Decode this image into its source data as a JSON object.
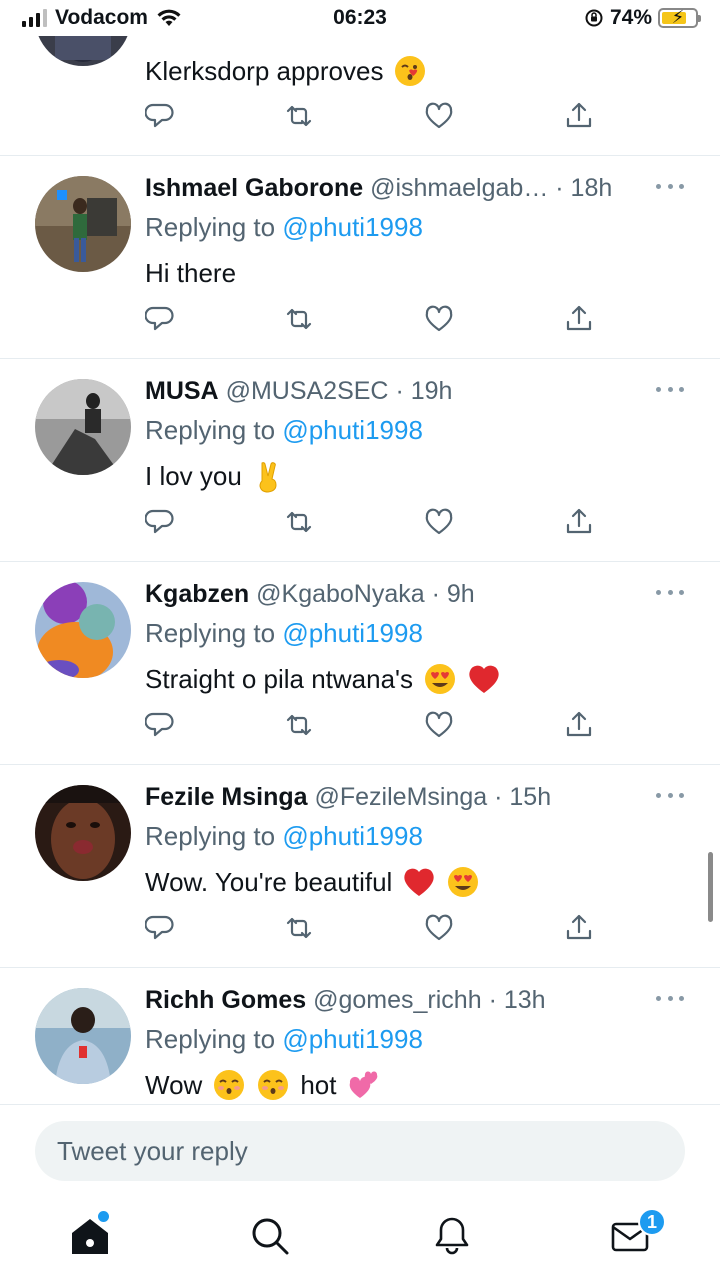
{
  "status_bar": {
    "carrier": "Vodacom",
    "time": "06:23",
    "battery_percent": "74%",
    "battery_level": 0.74
  },
  "top_tweet": {
    "text": "Klerksdorp approves",
    "emoji": [
      "kissing-heart-emoji"
    ]
  },
  "tweets": [
    {
      "name": "Ishmael Gaborone",
      "handle": "@ishmaelgab…",
      "time": "· 18h",
      "replying_prefix": "Replying to",
      "replying_to": "@phuti1998",
      "text": "Hi there"
    },
    {
      "name": "MUSA",
      "handle": "@MUSA2SEC",
      "time": "· 19h",
      "replying_prefix": "Replying to",
      "replying_to": "@phuti1998",
      "text": "I lov you"
    },
    {
      "name": "Kgabzen",
      "handle": "@KgaboNyaka",
      "time": "· 9h",
      "replying_prefix": "Replying to",
      "replying_to": "@phuti1998",
      "text": "Straight o pila ntwana's"
    },
    {
      "name": "Fezile Msinga",
      "handle": "@FezileMsinga",
      "time": "· 15h",
      "replying_prefix": "Replying to",
      "replying_to": "@phuti1998",
      "text": "Wow. You're beautiful"
    },
    {
      "name": "Richh Gomes",
      "handle": "@gomes_richh",
      "time": "· 13h",
      "replying_prefix": "Replying to",
      "replying_to": "@phuti1998",
      "text_a": "Wow",
      "text_b": "hot"
    }
  ],
  "reply_bar": {
    "placeholder": "Tweet your reply"
  },
  "tab_bar": {
    "items": [
      "home-icon",
      "search-icon",
      "bell-icon",
      "mail-icon"
    ],
    "mail_badge": "1"
  },
  "colors": {
    "accent": "#1d9bf0",
    "secondary_text": "#536471",
    "divider": "#e6ecf0"
  }
}
